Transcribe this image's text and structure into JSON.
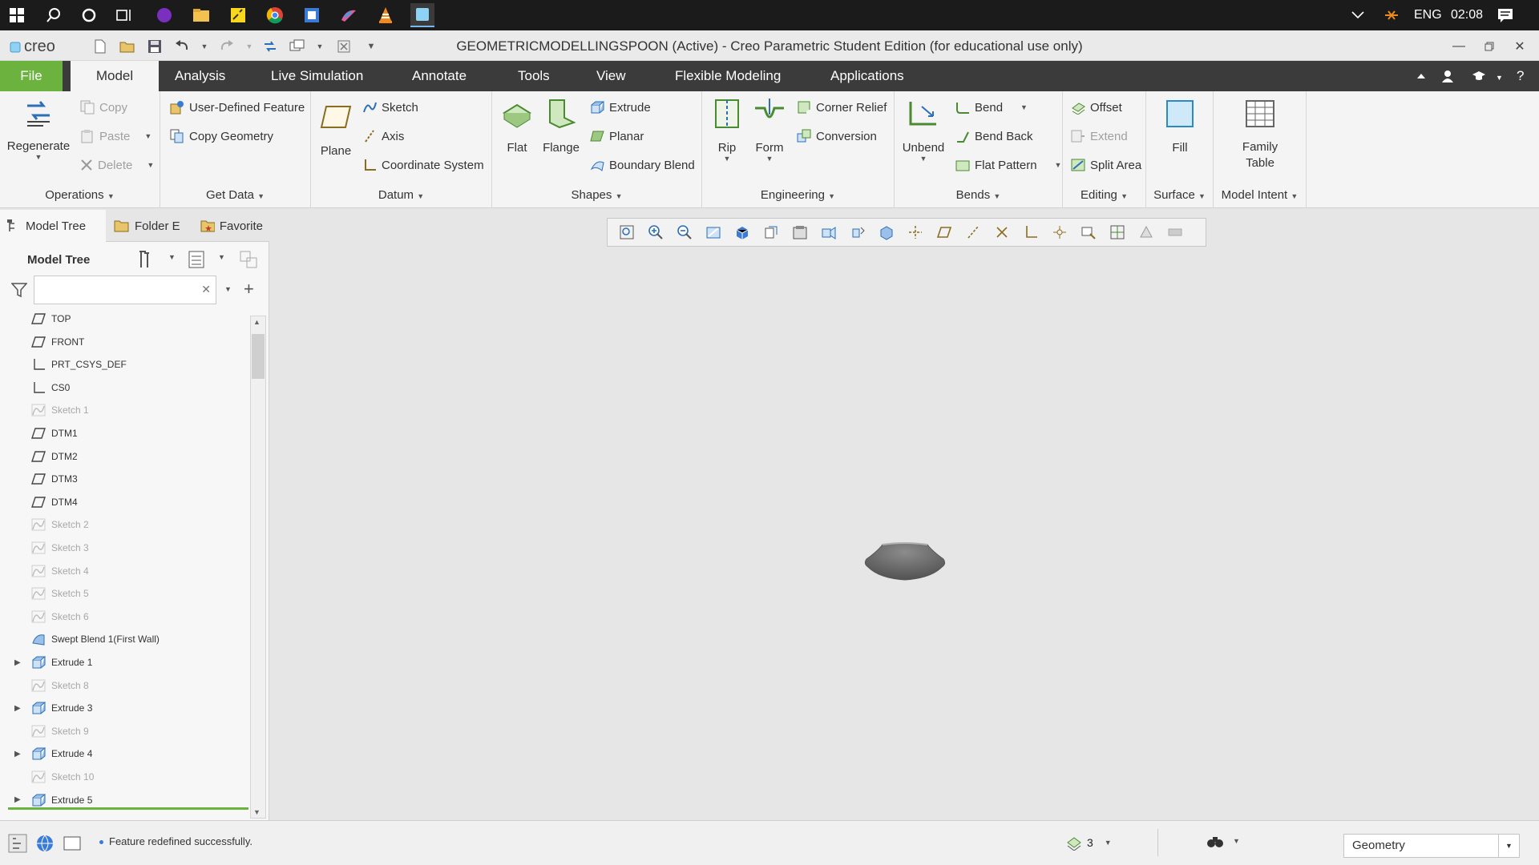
{
  "taskbar": {
    "lang": "ENG",
    "time": "02:08"
  },
  "window": {
    "app_logo": "creo",
    "title": "GEOMETRICMODELLINGSPOON (Active) - Creo Parametric Student Edition (for educational use only)"
  },
  "tabs": [
    "File",
    "Model",
    "Analysis",
    "Live Simulation",
    "Annotate",
    "Tools",
    "View",
    "Flexible Modeling",
    "Applications"
  ],
  "active_tab": "Model",
  "ribbon": {
    "operations": {
      "label": "Operations",
      "regenerate": "Regenerate",
      "copy": "Copy",
      "paste": "Paste",
      "delete": "Delete"
    },
    "get_data": {
      "label": "Get Data",
      "udf": "User-Defined Feature",
      "copy_geometry": "Copy Geometry"
    },
    "datum": {
      "label": "Datum",
      "plane": "Plane",
      "sketch": "Sketch",
      "axis": "Axis",
      "csys": "Coordinate System"
    },
    "shapes": {
      "label": "Shapes",
      "flat": "Flat",
      "flange": "Flange",
      "extrude": "Extrude",
      "planar": "Planar",
      "boundary_blend": "Boundary Blend"
    },
    "engineering": {
      "label": "Engineering",
      "rip": "Rip",
      "form": "Form",
      "corner_relief": "Corner Relief",
      "conversion": "Conversion"
    },
    "bends": {
      "label": "Bends",
      "unbend": "Unbend",
      "bend": "Bend",
      "bend_back": "Bend Back",
      "flat_pattern": "Flat Pattern"
    },
    "editing": {
      "label": "Editing",
      "offset": "Offset",
      "extend": "Extend",
      "split_area": "Split Area"
    },
    "surface": {
      "label": "Surface",
      "fill": "Fill"
    },
    "model_intent": {
      "label": "Model Intent",
      "family_table": "Family\nTable"
    }
  },
  "panel": {
    "tabs": [
      "Model Tree",
      "Folder E",
      "Favorite"
    ],
    "header": "Model Tree",
    "search_placeholder": "",
    "tree": [
      {
        "label": "TOP",
        "icon": "datum-plane-icon",
        "dim": false,
        "expand": false
      },
      {
        "label": "FRONT",
        "icon": "datum-plane-icon",
        "dim": false,
        "expand": false
      },
      {
        "label": "PRT_CSYS_DEF",
        "icon": "csys-icon",
        "dim": false,
        "expand": false
      },
      {
        "label": "CS0",
        "icon": "csys-icon",
        "dim": false,
        "expand": false
      },
      {
        "label": "Sketch 1",
        "icon": "sketch-icon",
        "dim": true,
        "expand": false
      },
      {
        "label": "DTM1",
        "icon": "datum-plane-icon",
        "dim": false,
        "expand": false
      },
      {
        "label": "DTM2",
        "icon": "datum-plane-icon",
        "dim": false,
        "expand": false
      },
      {
        "label": "DTM3",
        "icon": "datum-plane-icon",
        "dim": false,
        "expand": false
      },
      {
        "label": "DTM4",
        "icon": "datum-plane-icon",
        "dim": false,
        "expand": false
      },
      {
        "label": "Sketch 2",
        "icon": "sketch-icon",
        "dim": true,
        "expand": false
      },
      {
        "label": "Sketch 3",
        "icon": "sketch-icon",
        "dim": true,
        "expand": false
      },
      {
        "label": "Sketch 4",
        "icon": "sketch-icon",
        "dim": true,
        "expand": false
      },
      {
        "label": "Sketch 5",
        "icon": "sketch-icon",
        "dim": true,
        "expand": false
      },
      {
        "label": "Sketch 6",
        "icon": "sketch-icon",
        "dim": true,
        "expand": false
      },
      {
        "label": "Swept Blend 1(First Wall)",
        "icon": "swept-blend-icon",
        "dim": false,
        "expand": false
      },
      {
        "label": "Extrude 1",
        "icon": "extrude-icon",
        "dim": false,
        "expand": true
      },
      {
        "label": "Sketch 8",
        "icon": "sketch-icon",
        "dim": true,
        "expand": false
      },
      {
        "label": "Extrude 3",
        "icon": "extrude-icon",
        "dim": false,
        "expand": true
      },
      {
        "label": "Sketch 9",
        "icon": "sketch-icon",
        "dim": true,
        "expand": false
      },
      {
        "label": "Extrude 4",
        "icon": "extrude-icon",
        "dim": false,
        "expand": true
      },
      {
        "label": "Sketch 10",
        "icon": "sketch-icon",
        "dim": true,
        "expand": false
      },
      {
        "label": "Extrude 5",
        "icon": "extrude-icon",
        "dim": false,
        "expand": true
      }
    ]
  },
  "status": {
    "message": "Feature redefined successfully.",
    "layer_count": "3",
    "filter": "Geometry"
  },
  "colors": {
    "file_tab": "#6bb33e",
    "tabs_bar": "#3b3b3b",
    "model": "#707070"
  }
}
